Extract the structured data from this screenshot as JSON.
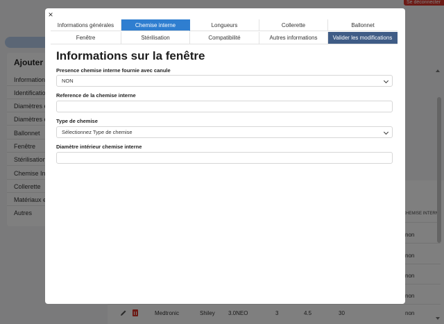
{
  "background": {
    "logout_label": "Se déconnecter",
    "sidebar_title": "Ajouter un",
    "sidebar_items": [
      "Informations",
      "Identification",
      "Diamètres et",
      "Diamètres et",
      "Ballonnet",
      "Fenêtre",
      "Stérilisation",
      "Chemise Interne",
      "Collerette",
      "Matériaux et",
      "Autres"
    ],
    "table_header_last": "CHEMISE INTERN",
    "table_cell_values": [
      "non",
      "non",
      "non",
      "non",
      "non"
    ],
    "last_row": {
      "brand": "Medtronic",
      "model": "Shiley",
      "size": "3.0NEO",
      "c1": "3",
      "c2": "4.5",
      "c3": "30",
      "last": "non"
    }
  },
  "modal": {
    "close_label": "×",
    "tabs_row1": [
      {
        "label": "Informations générales"
      },
      {
        "label": "Chemise interne"
      },
      {
        "label": "Longueurs"
      },
      {
        "label": "Collerette"
      },
      {
        "label": "Ballonnet"
      }
    ],
    "tabs_row2": [
      {
        "label": "Fenêtre"
      },
      {
        "label": "Stérilisation"
      },
      {
        "label": "Compatibilité"
      },
      {
        "label": "Autres informations"
      },
      {
        "label": "Valider les modifications"
      }
    ],
    "title": "Informations sur la fenêtre",
    "fields": [
      {
        "label": "Presence chemise interne fournie avec canule",
        "value": "NON"
      },
      {
        "label": "Reference de la chemise interne",
        "value": ""
      },
      {
        "label": "Type de chemise",
        "value": "Sélectionnez Type de chemise"
      },
      {
        "label": "Diamètre intérieur chemise interne",
        "value": ""
      }
    ]
  }
}
